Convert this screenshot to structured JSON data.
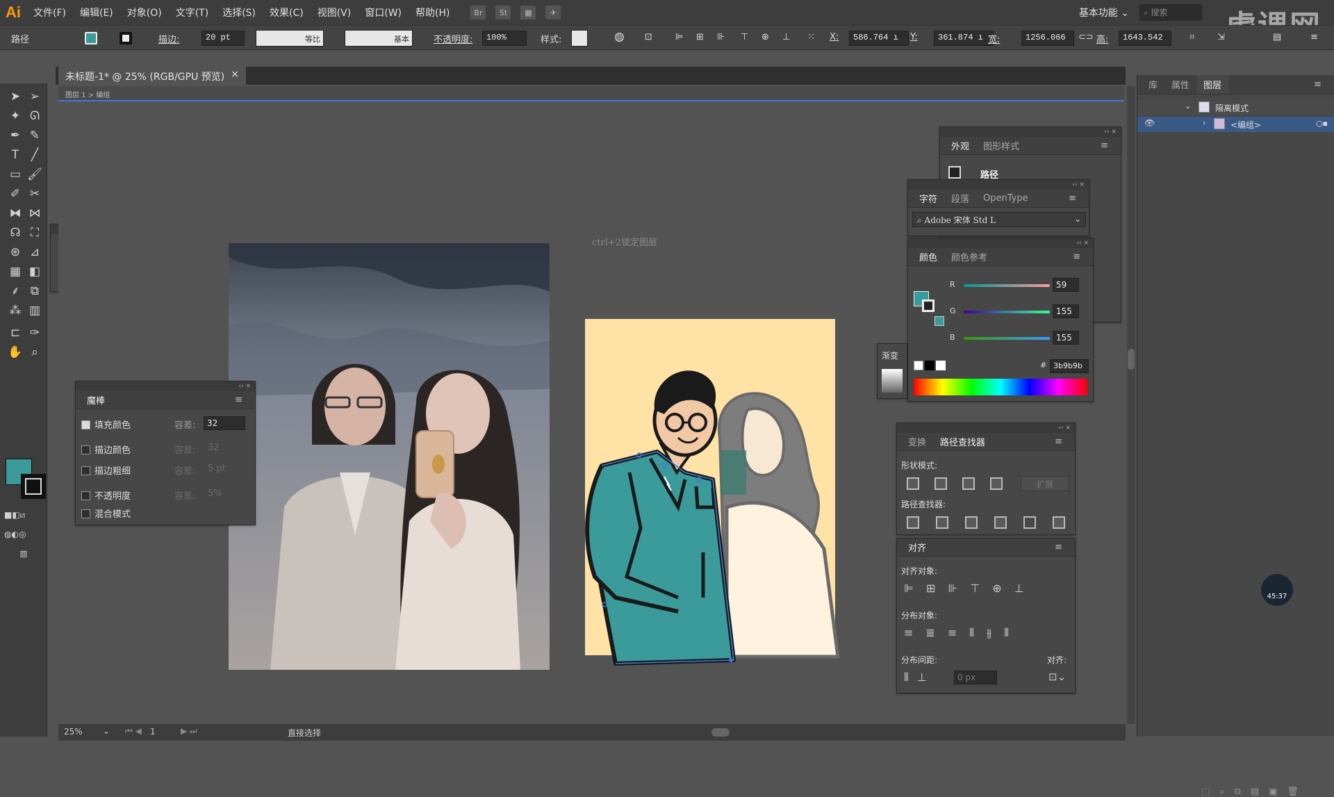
{
  "app": {
    "logo": "Ai"
  },
  "menu": [
    "文件(F)",
    "编辑(E)",
    "对象(O)",
    "文字(T)",
    "选择(S)",
    "效果(C)",
    "视图(V)",
    "窗口(W)",
    "帮助(H)"
  ],
  "menubar_icons": {
    "br": "Br",
    "st": "St"
  },
  "workspace": "基本功能",
  "search_placeholder": "搜索",
  "watermark": "虎课网",
  "control": {
    "type_label": "路径",
    "stroke_label": "描边:",
    "stroke_value": "20 pt",
    "profile1": "等比",
    "profile2": "基本",
    "opacity_label": "不透明度:",
    "opacity_value": "100%",
    "style_label": "样式:",
    "x_label": "X:",
    "x_value": "586.764 ı",
    "y_label": "Y:",
    "y_value": "361.874 ı",
    "w_label": "宽:",
    "w_value": "1256.066",
    "h_label": "高:",
    "h_value": "1643.542"
  },
  "document": {
    "tab_title": "未标题-1* @ 25% (RGB/GPU 预览)",
    "close": "×",
    "breadcrumb": "图层 1 > 编组"
  },
  "canvas": {
    "hint": "ctrl+2锁定图层"
  },
  "status": {
    "zoom": "25%",
    "page": "1",
    "tool": "直接选择"
  },
  "colors": {
    "fill": "#3b9b9b",
    "artboard": "#ffe3a6",
    "accent": "#3d7bd6"
  },
  "magic_wand": {
    "title": "魔棒",
    "rows": [
      {
        "label": "填充颜色",
        "checked": true,
        "tol_label": "容差:",
        "tol_value": "32"
      },
      {
        "label": "描边颜色",
        "checked": false,
        "tol_label": "容差:",
        "tol_value": "32"
      },
      {
        "label": "描边粗细",
        "checked": false,
        "tol_label": "容差:",
        "tol_value": "5 pt"
      },
      {
        "label": "不透明度",
        "checked": false,
        "tol_label": "容差:",
        "tol_value": "5%"
      },
      {
        "label": "混合模式",
        "checked": false
      }
    ]
  },
  "appearance": {
    "tabs": [
      "外观",
      "图形样式"
    ],
    "item": "路径"
  },
  "character": {
    "tabs": [
      "字符",
      "段落",
      "OpenType"
    ],
    "font": "Adobe 宋体 Std L"
  },
  "color_panel": {
    "tabs": [
      "颜色",
      "颜色参考"
    ],
    "r_label": "R",
    "r_value": "59",
    "g_label": "G",
    "g_value": "155",
    "b_label": "B",
    "b_value": "155",
    "hex_label": "#",
    "hex": "3b9b9b"
  },
  "gradient": {
    "tab": "渐变"
  },
  "pathfinder": {
    "tabs": [
      "变换",
      "路径查找器"
    ],
    "shape_modes": "形状模式:",
    "expand": "扩展",
    "pathfinders": "路径查找器:"
  },
  "align": {
    "tab": "对齐",
    "align_objects": "对齐对象:",
    "distribute_objects": "分布对象:",
    "distribute_spacing": "分布间距:",
    "align_to": "对齐:",
    "spacing_value": "0 px"
  },
  "layers": {
    "tabs": [
      "库",
      "属性",
      "图层"
    ],
    "items": [
      {
        "label": "隔离模式"
      },
      {
        "label": "<编组>"
      }
    ]
  },
  "timer": "45:37"
}
